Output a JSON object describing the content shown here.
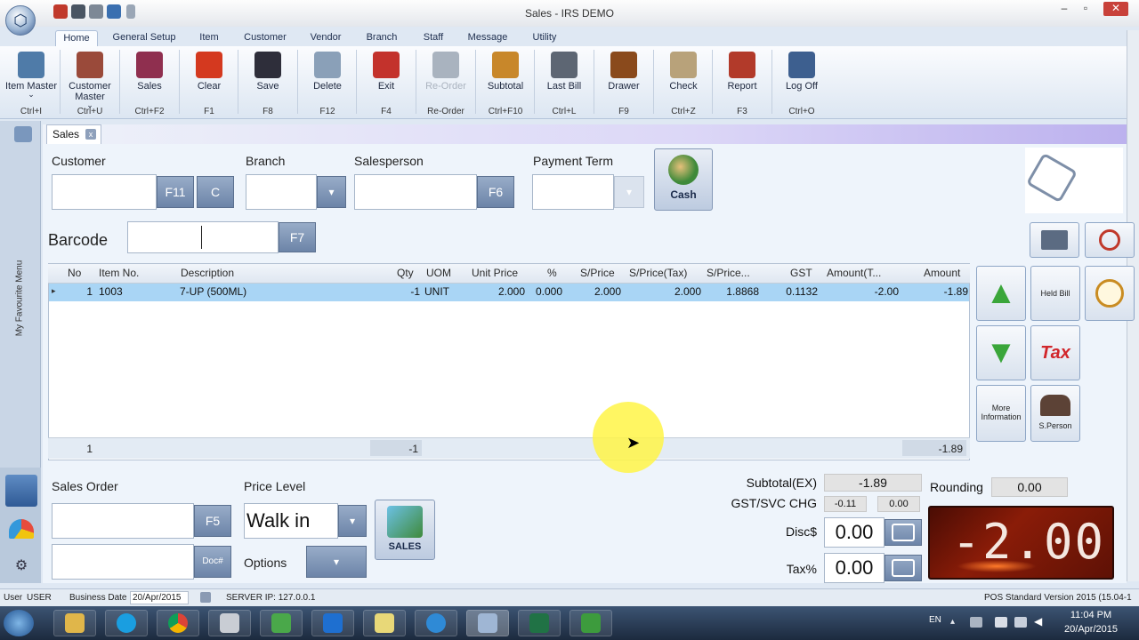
{
  "window": {
    "title": "Sales - IRS DEMO",
    "min": "–",
    "max": "▫",
    "close": "✕"
  },
  "ribbon_tabs": [
    "Home",
    "General Setup",
    "Item",
    "Customer",
    "Vendor",
    "Branch",
    "Staff",
    "Message",
    "Utility"
  ],
  "ribbon_buttons": [
    {
      "label": "Item Master",
      "shortcut": "Ctrl+I",
      "icon": "item-master-icon",
      "color": "#4f7ba8"
    },
    {
      "label": "Customer Master",
      "shortcut": "Ctrl+U",
      "icon": "customer-master-icon",
      "color": "#9a4a3a"
    },
    {
      "label": "Sales",
      "shortcut": "Ctrl+F2",
      "icon": "sales-cart-icon",
      "color": "#8f2f4f"
    },
    {
      "label": "Clear",
      "shortcut": "F1",
      "icon": "clear-icon",
      "color": "#d4391f"
    },
    {
      "label": "Save",
      "shortcut": "F8",
      "icon": "save-icon",
      "color": "#2e2e3a"
    },
    {
      "label": "Delete",
      "shortcut": "F12",
      "icon": "delete-icon",
      "color": "#8aa0b8"
    },
    {
      "label": "Exit",
      "shortcut": "F4",
      "icon": "exit-icon",
      "color": "#c3322c"
    },
    {
      "label": "Re-Order",
      "shortcut": "Re-Order",
      "icon": "reorder-icon",
      "color": "#a9b3bf"
    },
    {
      "label": "Subtotal",
      "shortcut": "Ctrl+F10",
      "icon": "subtotal-icon",
      "color": "#c8872a"
    },
    {
      "label": "Last Bill",
      "shortcut": "Ctrl+L",
      "icon": "last-bill-icon",
      "color": "#5d6673"
    },
    {
      "label": "Drawer",
      "shortcut": "F9",
      "icon": "drawer-icon",
      "color": "#8a4a1c"
    },
    {
      "label": "Check",
      "shortcut": "Ctrl+Z",
      "icon": "check-icon",
      "color": "#b8a27a"
    },
    {
      "label": "Report",
      "shortcut": "F3",
      "icon": "report-icon",
      "color": "#b23a2a"
    },
    {
      "label": "Log Off",
      "shortcut": "Ctrl+O",
      "icon": "log-off-icon",
      "color": "#3d5f8f"
    }
  ],
  "doc_tab": {
    "label": "Sales",
    "close": "x"
  },
  "favourite_menu": "My Favourite Menu",
  "form": {
    "customer_label": "Customer",
    "customer_value": "",
    "customer_key1": "F11",
    "customer_key2": "C",
    "branch_label": "Branch",
    "branch_value": "",
    "salesperson_label": "Salesperson",
    "salesperson_value": "",
    "salesperson_key": "F6",
    "payment_label": "Payment Term",
    "payment_value": "",
    "cash_label": "Cash",
    "barcode_label": "Barcode",
    "barcode_value": "",
    "barcode_key": "F7"
  },
  "grid": {
    "columns": [
      "No",
      "Item No.",
      "Description",
      "Qty",
      "UOM",
      "Unit Price",
      "%",
      "S/Price",
      "S/Price(Tax)",
      "S/Price...",
      "GST",
      "Amount(T...",
      "Amount"
    ],
    "rows": [
      [
        "1",
        "1003",
        "7-UP (500ML)",
        "-1",
        "UNIT",
        "2.000",
        "0.000",
        "2.000",
        "2.000",
        "1.8868",
        "0.1132",
        "-2.00",
        "-1.89"
      ]
    ],
    "footer": {
      "count": "1",
      "qty": "-1",
      "amount": "-1.89"
    }
  },
  "side_buttons": {
    "held_bill": "Held Bill",
    "tax": "Tax",
    "more_info": "More Information",
    "sperson": "S.Person"
  },
  "lower": {
    "sales_order_label": "Sales Order",
    "sales_order_value": "",
    "sales_order_key": "F5",
    "doc_key": "Doc#",
    "doc_value": "",
    "price_level_label": "Price Level",
    "price_level_value": "Walk in",
    "options_label": "Options",
    "sales_btn": "SALES"
  },
  "totals": {
    "subtotal_label": "Subtotal(EX)",
    "subtotal_value": "-1.89",
    "gst_label": "GST/SVC CHG",
    "gst_value": "-0.11",
    "svc_value": "0.00",
    "disc_label": "Disc$",
    "disc_value": "0.00",
    "tax_label": "Tax%",
    "tax_value": "0.00",
    "rounding_label": "Rounding",
    "rounding_value": "0.00",
    "display_total": "-2.00"
  },
  "status": {
    "user_label": "User",
    "user_value": "USER",
    "bdate_label": "Business Date",
    "bdate_value": "20/Apr/2015",
    "server": "SERVER IP: 127.0.0.1",
    "version": "POS Standard Version 2015 (15.04-1"
  },
  "taskbar": {
    "lang": "EN",
    "time": "11:04 PM",
    "date": "20/Apr/2015"
  }
}
